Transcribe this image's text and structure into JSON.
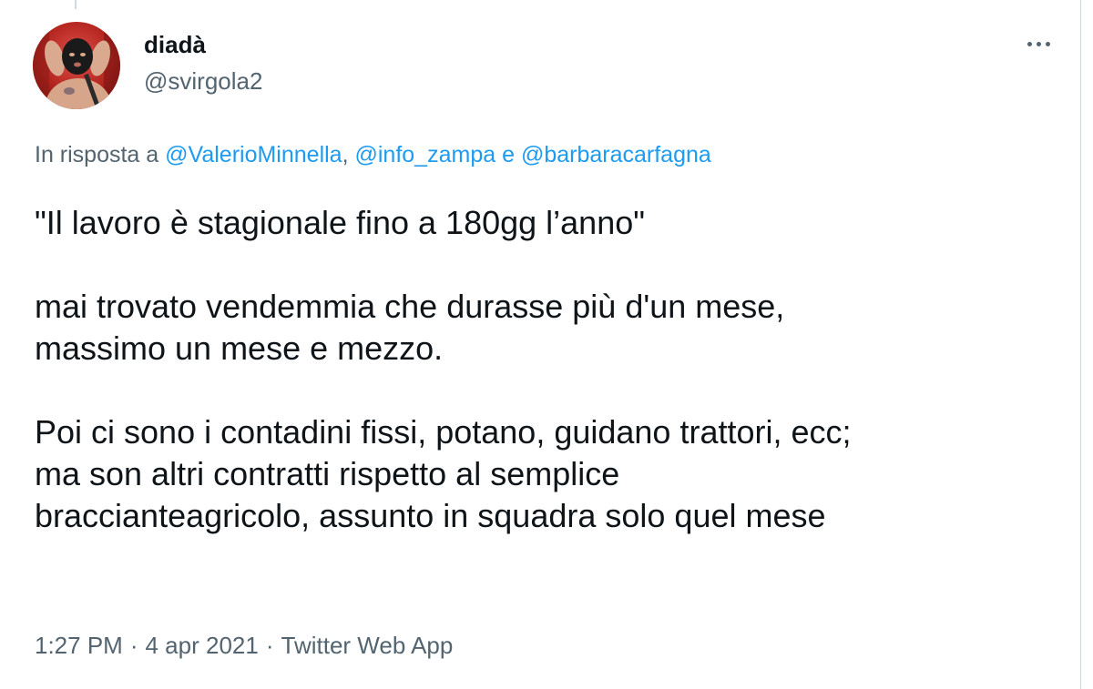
{
  "author": {
    "display_name": "diadà",
    "handle": "@svirgola2"
  },
  "reply_context": {
    "prefix": "In risposta a",
    "mentions": [
      "@ValerioMinnella",
      "@info_zampa",
      "@barbaracarfagna"
    ],
    "separator_comma": ",",
    "conjunction": "e"
  },
  "tweet": {
    "paragraphs": [
      [
        "\"Il lavoro è stagionale fino a 180gg l’anno\""
      ],
      [
        "mai trovato vendemmia che durasse più d'un mese,",
        "massimo un mese e mezzo."
      ],
      [
        "Poi ci sono i contadini fissi, potano, guidano trattori, ecc;",
        "ma son altri contratti rispetto al semplice",
        "braccianteagricolo, assunto in squadra solo quel mese"
      ]
    ]
  },
  "meta": {
    "time": "1:27 PM",
    "date": "4 apr 2021",
    "separator": "·",
    "source": "Twitter Web App"
  },
  "icons": {
    "more": "more-horizontal-icon"
  },
  "colors": {
    "text": "#0f1419",
    "secondary": "#536471",
    "link": "#1d9bf0",
    "border": "#cfd9de"
  }
}
